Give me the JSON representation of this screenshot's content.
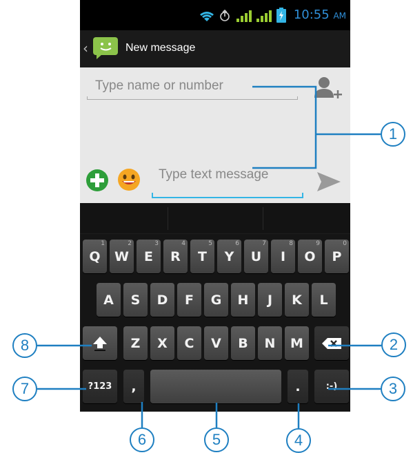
{
  "status_bar": {
    "time": "10:55",
    "ampm": "AM",
    "icons": [
      "wifi-icon",
      "data-transfer-icon",
      "signal-bars-icon",
      "signal-bars-icon",
      "battery-charging-icon"
    ]
  },
  "action_bar": {
    "back_icon": "chevron-left-icon",
    "app_icon": "messaging-app-icon",
    "title": "New message"
  },
  "compose": {
    "recipient_placeholder": "Type name or number",
    "add_contact_icon": "add-contact-icon",
    "attach_icon": "add-attachment-icon",
    "emoji_icon": "emoji-icon",
    "message_placeholder": "Type text message",
    "send_icon": "send-icon"
  },
  "keyboard": {
    "row1": [
      {
        "label": "Q",
        "hint": "1"
      },
      {
        "label": "W",
        "hint": "2"
      },
      {
        "label": "E",
        "hint": "3"
      },
      {
        "label": "R",
        "hint": "4"
      },
      {
        "label": "T",
        "hint": "5"
      },
      {
        "label": "Y",
        "hint": "6"
      },
      {
        "label": "U",
        "hint": "7"
      },
      {
        "label": "I",
        "hint": "8"
      },
      {
        "label": "O",
        "hint": "9"
      },
      {
        "label": "P",
        "hint": "0"
      }
    ],
    "row2": [
      "A",
      "S",
      "D",
      "F",
      "G",
      "H",
      "J",
      "K",
      "L"
    ],
    "row3": [
      "Z",
      "X",
      "C",
      "V",
      "B",
      "N",
      "M"
    ],
    "shift_icon": "shift-icon",
    "backspace_icon": "backspace-icon",
    "symbols_label": "?123",
    "comma_label": ",",
    "period_label": ".",
    "smiley_label": ":-)"
  },
  "callouts": [
    "1",
    "2",
    "3",
    "4",
    "5",
    "6",
    "7",
    "8"
  ],
  "colors": {
    "callout_blue": "#1e7fc1",
    "accent": "#33b5e5",
    "status_time": "#2f8fd8",
    "signal_bars": "#9acd32",
    "message_icon_green": "#8bc34a"
  }
}
